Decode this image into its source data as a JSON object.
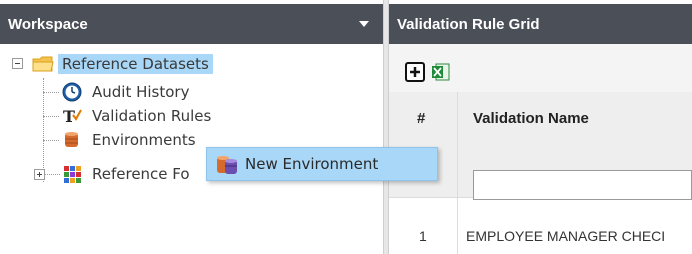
{
  "workspace": {
    "title": "Workspace",
    "tree": {
      "root_label": "Reference Datasets",
      "items": [
        {
          "label": "Audit History",
          "icon": "clock-icon"
        },
        {
          "label": "Validation Rules",
          "icon": "validation-rules-icon"
        },
        {
          "label": "Environments",
          "icon": "database-icon"
        },
        {
          "label": "Reference Fo",
          "icon": "grid-colors-icon"
        }
      ]
    }
  },
  "context_menu": {
    "item_label": "New Environment",
    "icon": "database-icon"
  },
  "grid": {
    "title": "Validation Rule Grid",
    "toolbar": {
      "add_icon": "add-icon",
      "export_icon": "excel-export-icon"
    },
    "columns": [
      "#",
      "Validation Name"
    ],
    "filter_value": "",
    "rows": [
      {
        "num": "1",
        "name": "EMPLOYEE MANAGER CHECI"
      }
    ]
  },
  "colors": {
    "header_bg": "#4b4f58",
    "selection": "#a9d7f7"
  }
}
